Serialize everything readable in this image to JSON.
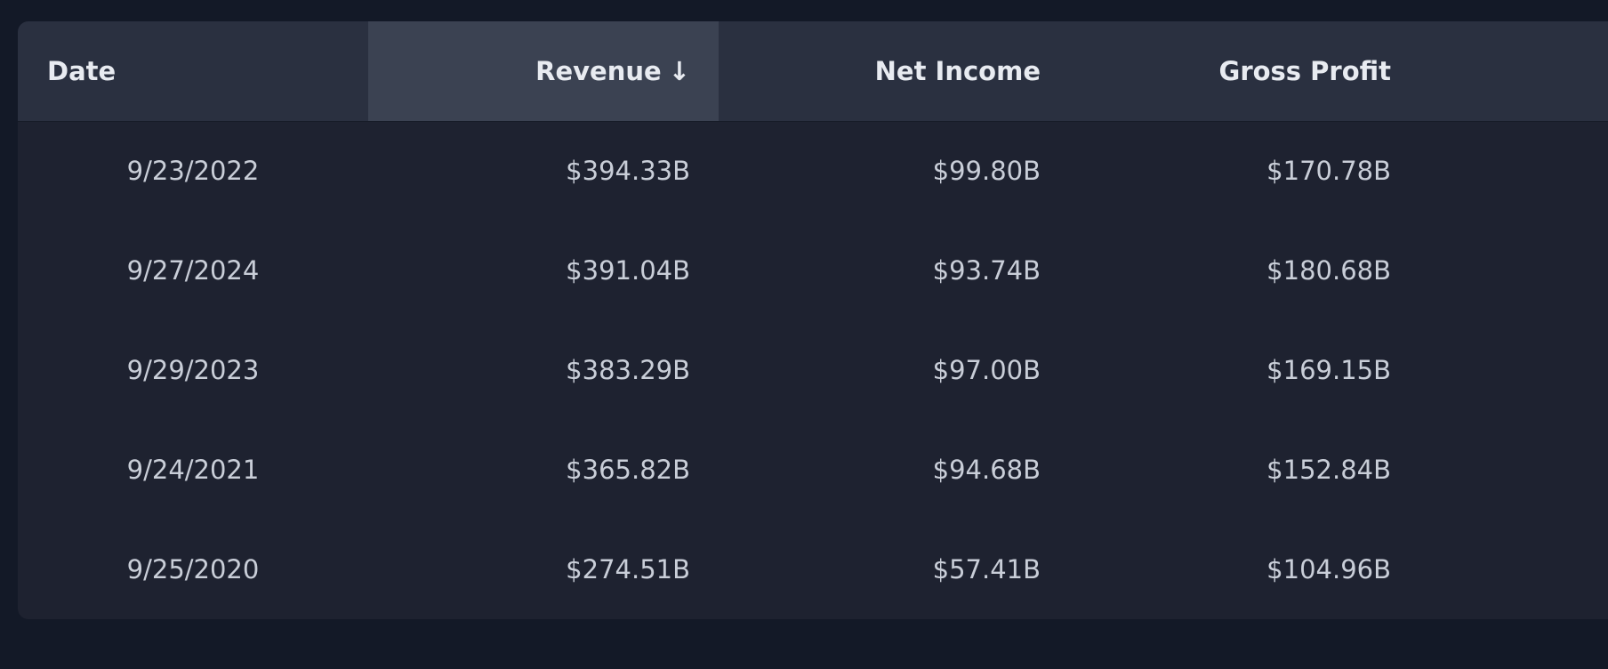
{
  "table": {
    "columns": [
      {
        "label": "Date",
        "sort_indicator": ""
      },
      {
        "label": "Revenue",
        "sort_indicator": "↓"
      },
      {
        "label": "Net Income",
        "sort_indicator": ""
      },
      {
        "label": "Gross Profit",
        "sort_indicator": ""
      }
    ],
    "sorted_column": "Revenue",
    "sort_direction": "descending",
    "rows": [
      {
        "date": "9/23/2022",
        "revenue": "$394.33B",
        "net_income": "$99.80B",
        "gross_profit": "$170.78B"
      },
      {
        "date": "9/27/2024",
        "revenue": "$391.04B",
        "net_income": "$93.74B",
        "gross_profit": "$180.68B"
      },
      {
        "date": "9/29/2023",
        "revenue": "$383.29B",
        "net_income": "$97.00B",
        "gross_profit": "$169.15B"
      },
      {
        "date": "9/24/2021",
        "revenue": "$365.82B",
        "net_income": "$94.68B",
        "gross_profit": "$152.84B"
      },
      {
        "date": "9/25/2020",
        "revenue": "$274.51B",
        "net_income": "$57.41B",
        "gross_profit": "$104.96B"
      }
    ]
  },
  "colors": {
    "page_background": "#131927",
    "table_background": "#1e2230",
    "header_background": "#2a3040",
    "sorted_header_background": "#3b4252",
    "header_text": "#e8ebf1",
    "cell_text": "#c9ced8"
  }
}
